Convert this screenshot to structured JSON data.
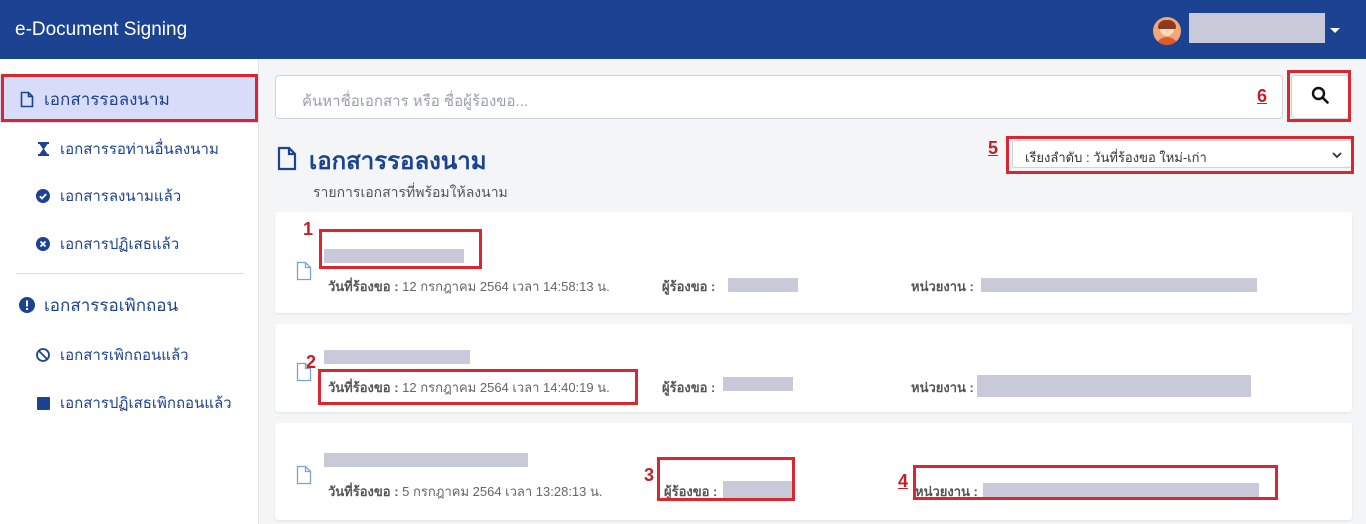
{
  "header": {
    "app_title": "e-Document Signing",
    "user_menu": "user-menu"
  },
  "sidebar": {
    "items": [
      {
        "label": "เอกสารรอลงนาม",
        "icon": "file-icon"
      },
      {
        "label": "เอกสารรอท่านอื่นลงนาม",
        "icon": "hourglass-icon"
      },
      {
        "label": "เอกสารลงนามแล้ว",
        "icon": "check-circle-icon"
      },
      {
        "label": "เอกสารปฏิเสธแล้ว",
        "icon": "x-circle-icon"
      },
      {
        "label": "เอกสารรอเพิกถอน",
        "icon": "exclamation-circle-icon"
      },
      {
        "label": "เอกสารเพิกถอนแล้ว",
        "icon": "ban-icon"
      },
      {
        "label": "เอกสารปฏิเสธเพิกถอนแล้ว",
        "icon": "square-icon"
      }
    ]
  },
  "search": {
    "placeholder": "ค้นหาชื่อเอกสาร หรือ ชื่อผู้ร้องขอ..."
  },
  "main": {
    "title": "เอกสารรอลงนาม",
    "subtitle": "รายการเอกสารที่พร้อมให้ลงนาม",
    "sort_value": "เรียงลำดับ : วันที่ร้องขอ ใหม่-เก่า"
  },
  "labels": {
    "request_date": "วันที่ร้องขอ :",
    "requester": "ผู้ร้องขอ :",
    "agency": "หน่วยงาน :"
  },
  "documents": [
    {
      "date": "12 กรกฎาคม 2564 เวลา 14:58:13 น."
    },
    {
      "date": "12 กรกฎาคม 2564 เวลา 14:40:19 น."
    },
    {
      "date": "5 กรกฎาคม 2564 เวลา 13:28:13 น."
    }
  ],
  "annotations": [
    "1",
    "2",
    "3",
    "4",
    "5",
    "6"
  ],
  "colors": {
    "primary": "#1b4391",
    "annotation": "#d9262f",
    "active_bg": "#d7dcf9"
  }
}
